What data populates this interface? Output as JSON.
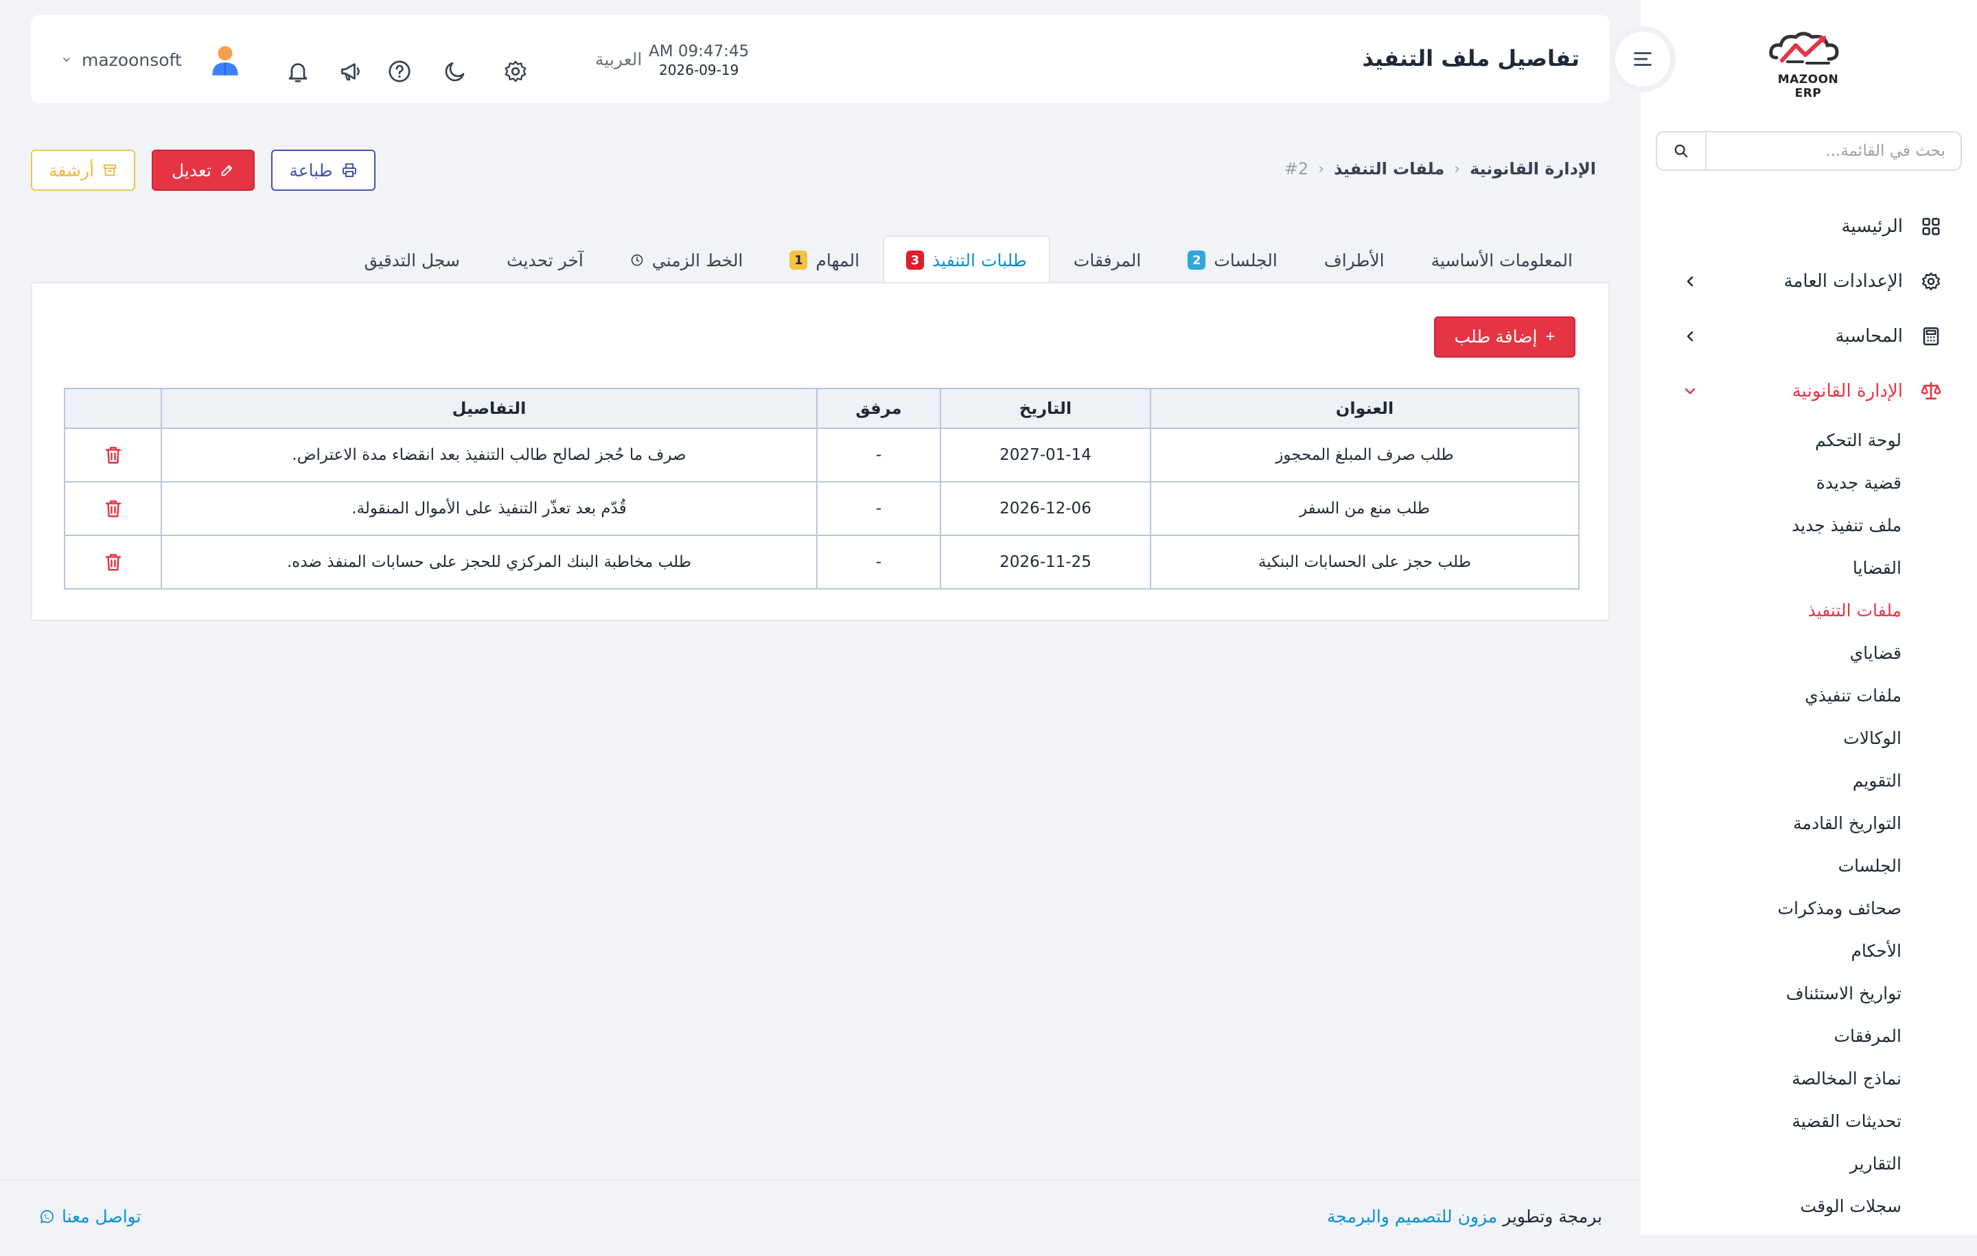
{
  "app": {
    "logo_text": "MAZOON ERP",
    "logo_sub": "ERP-ERP"
  },
  "header": {
    "title": "تفاصيل ملف التنفيذ",
    "time": "AM 09:47:45",
    "date": "2026-09-19",
    "language": "العربية",
    "username": "mazoonsoft"
  },
  "sidebar": {
    "search_placeholder": "بحث في القائمة...",
    "items": [
      {
        "label": "الرئيسية",
        "icon": "grid-icon"
      },
      {
        "label": "الإعدادات العامة",
        "icon": "gear-icon"
      },
      {
        "label": "المحاسبة",
        "icon": "calculator-icon"
      },
      {
        "label": "الإدارة القانونية",
        "icon": "scale-icon"
      }
    ],
    "sub_items": [
      "لوحة التحكم",
      "قضية جديدة",
      "ملف تنفيذ جديد",
      "القضايا",
      "ملفات التنفيذ",
      "قضاياي",
      "ملفات تنفيذي",
      "الوكالات",
      "التقويم",
      "التواريخ القادمة",
      "الجلسات",
      "صحائف ومذكرات",
      "الأحكام",
      "تواريخ الاستئناف",
      "المرفقات",
      "نماذج المخالصة",
      "تحديثات القضية",
      "التقارير",
      "سجلات الوقت"
    ],
    "active_sub": "ملفات التنفيذ"
  },
  "breadcrumb": {
    "level1": "الإدارة القانونية",
    "level2": "ملفات التنفيذ",
    "current": "#2"
  },
  "actions": {
    "print": "طباعة",
    "edit": "تعديل",
    "archive": "أرشفة"
  },
  "tabs": [
    {
      "label": "المعلومات الأساسية",
      "badge": ""
    },
    {
      "label": "الأطراف",
      "badge": ""
    },
    {
      "label": "الجلسات",
      "badge": "2"
    },
    {
      "label": "المرفقات",
      "badge": ""
    },
    {
      "label": "طلبات التنفيذ",
      "badge": "3"
    },
    {
      "label": "المهام",
      "badge": "1"
    },
    {
      "label": "الخط الزمني",
      "badge": ""
    },
    {
      "label": "آخر تحديث",
      "badge": ""
    },
    {
      "label": "سجل التدقيق",
      "badge": ""
    }
  ],
  "panel": {
    "add_button": "إضافة طلب",
    "columns": [
      "العنوان",
      "التاريخ",
      "مرفق",
      "التفاصيل",
      ""
    ],
    "rows": [
      {
        "title": "طلب صرف المبلغ المحجوز",
        "date": "2027-01-14",
        "attachment": "-",
        "details": "صرف ما حُجز لصالح طالب التنفيذ بعد انقضاء مدة الاعتراض."
      },
      {
        "title": "طلب منع من السفر",
        "date": "2026-12-06",
        "attachment": "-",
        "details": "قُدّم بعد تعذّر التنفيذ على الأموال المنقولة."
      },
      {
        "title": "طلب حجز على الحسابات البنكية",
        "date": "2026-11-25",
        "attachment": "-",
        "details": "طلب مخاطبة البنك المركزي للحجز على حسابات المنفذ ضده."
      }
    ]
  },
  "footer": {
    "credit_prefix": "برمجة وتطوير",
    "credit_link": "مزون للتصميم والبرمجة",
    "contact": "تواصل معنا"
  },
  "colors": {
    "accent_red": "#e53545",
    "link_blue": "#0a8fd2",
    "print_blue": "#4455a8",
    "archive_yellow": "#f0b737"
  }
}
